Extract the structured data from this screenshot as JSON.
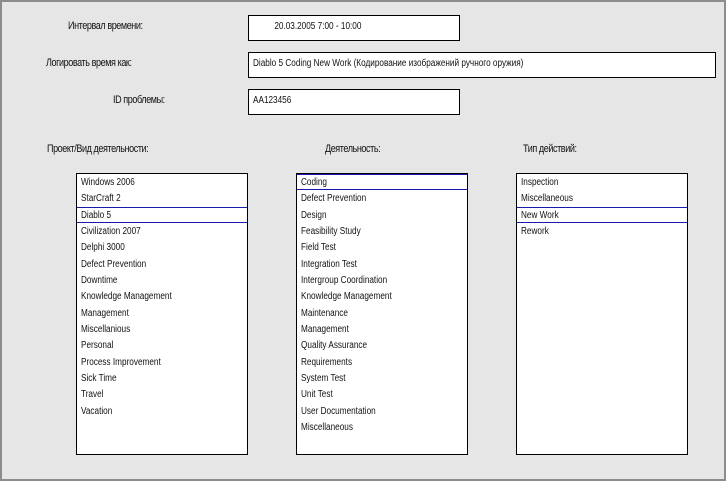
{
  "form": {
    "time_interval_label": "Интервал времени:",
    "time_interval_value": "20.03.2005  7:00 - 10:00",
    "log_time_label": "Логировать время как:",
    "log_time_value": "Diablo 5 Coding New Work (Кодирование изображений ручного оружия)",
    "problem_id_label": "ID проблемы:",
    "problem_id_value": "AA123456"
  },
  "columns": {
    "project": {
      "label": "Проект/Вид деятельности:",
      "selected": "Diablo 5",
      "items": [
        "Windows 2006",
        "StarCraft 2",
        "Diablo 5",
        "Civilization 2007",
        "Delphi 3000",
        "Defect Prevention",
        "Downtime",
        "Knowledge Management",
        "Management",
        "Miscellanious",
        "Personal",
        "Process Improvement",
        "Sick Time",
        "Travel",
        "Vacation"
      ]
    },
    "activity": {
      "label": "Деятельность:",
      "selected": "Coding",
      "items": [
        "Coding",
        "Defect Prevention",
        "Design",
        "Feasibility Study",
        "Field Test",
        "Integration Test",
        "Intergroup Coordination",
        "Knowledge Management",
        "Maintenance",
        "Management",
        "Quality Assurance",
        "Requirements",
        "System Test",
        "Unit Test",
        "User Documentation",
        "Miscellaneous"
      ]
    },
    "action_type": {
      "label": "Тип действий:",
      "selected": "New Work",
      "items": [
        "Inspection",
        "Miscellaneous",
        "New Work",
        "Rework"
      ]
    }
  }
}
